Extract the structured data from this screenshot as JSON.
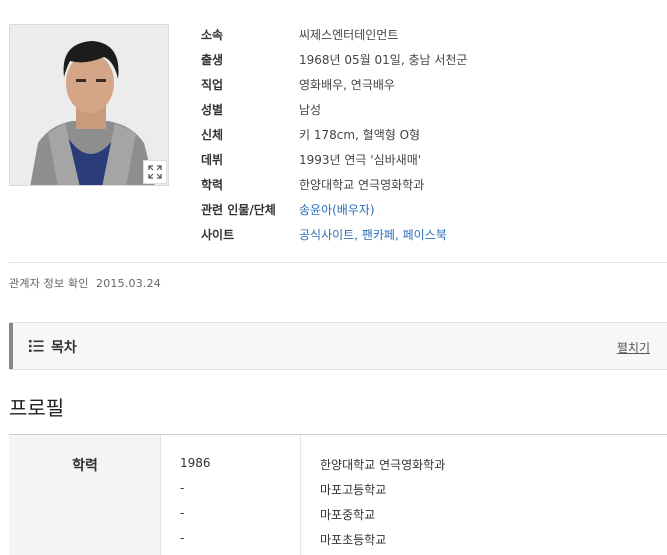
{
  "profile": {
    "rows": [
      {
        "key": "소속",
        "value": "씨제스엔터테인먼트"
      },
      {
        "key": "출생",
        "value": "1968년 05월 01일, 충남 서천군"
      },
      {
        "key": "직업",
        "value": "영화배우, 연극배우"
      },
      {
        "key": "성별",
        "value": "남성"
      },
      {
        "key": "신체",
        "value": "키 178cm, 혈액형 O형"
      },
      {
        "key": "데뷔",
        "value": "1993년 연극 '심바새매'"
      },
      {
        "key": "학력",
        "value": "한양대학교 연극영화학과"
      },
      {
        "key": "관련 인물/단체",
        "value": "송윤아(배우자)"
      },
      {
        "key": "사이트",
        "value": "공식사이트, 팬카페, 페이스북"
      }
    ],
    "photo_icon": "expand-icon"
  },
  "confirm_text": "관계자 정보 확인  2015.03.24",
  "toc": {
    "title": "목차",
    "expand_label": "펼치기",
    "icon": "list-icon"
  },
  "section": {
    "title": "프로필"
  },
  "education": {
    "label": "학력",
    "entries": [
      {
        "year": "1986",
        "school": "한양대학교 연극영화학과"
      },
      {
        "year": "-",
        "school": "마포고등학교"
      },
      {
        "year": "-",
        "school": "마포중학교"
      },
      {
        "year": "-",
        "school": "마포초등학교"
      }
    ]
  }
}
